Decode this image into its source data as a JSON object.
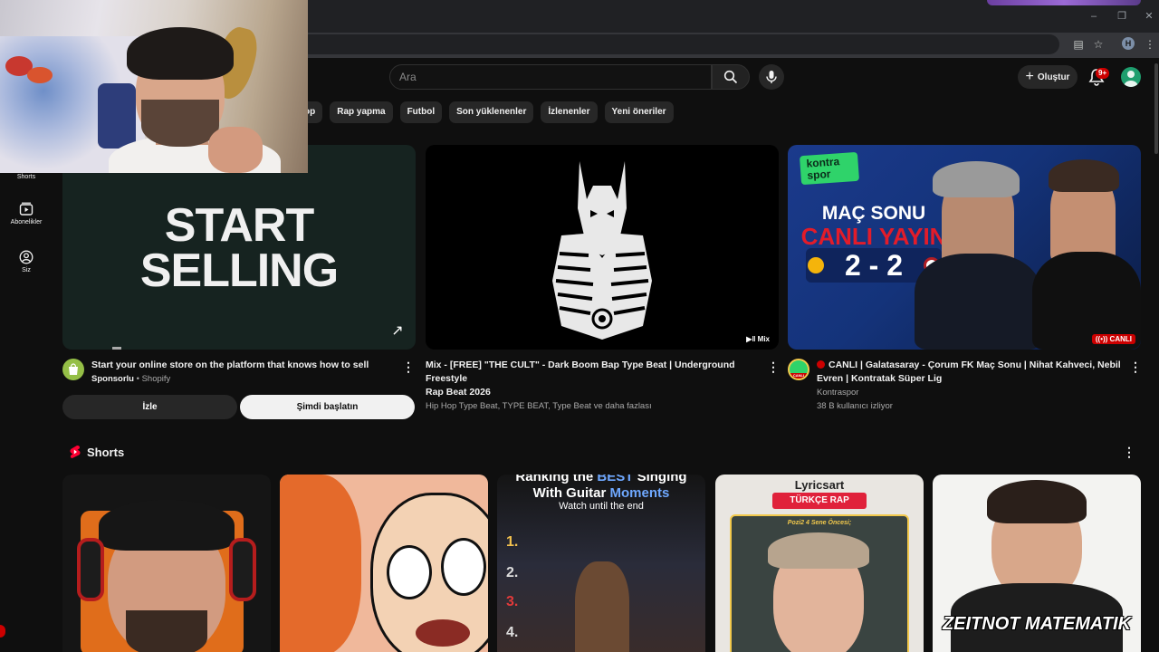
{
  "header": {
    "search_placeholder": "Ara",
    "create_label": "Oluştur",
    "notifications_badge": "9+",
    "profile_initial": "H"
  },
  "chips": [
    "op",
    "Rap yapma",
    "Futbol",
    "Son yüklenenler",
    "İzlenenler",
    "Yeni öneriler"
  ],
  "sidebar": {
    "items": [
      {
        "label": "Shorts",
        "icon": "shorts-icon"
      },
      {
        "label": "Abonelikler",
        "icon": "subscriptions-icon"
      },
      {
        "label": "Siz",
        "icon": "you-icon"
      }
    ]
  },
  "videos": [
    {
      "thumb_text_1": "START",
      "thumb_text_2": "SELLING",
      "title": "Start your online store on the platform that knows how to sell",
      "sponsored": "Sponsorlu",
      "channel": "Shopify",
      "button_watch": "İzle",
      "button_start": "Şimdi başlatın"
    },
    {
      "badge": "Mix",
      "title_line1": "Mix - [FREE] \"THE CULT\" - Dark Boom Bap Type Beat | Underground Freestyle",
      "title_line2": "Rap Beat 2026",
      "subtitle": "Hip Hop Type Beat, TYPE BEAT, Type Beat ve daha fazlası"
    },
    {
      "logo_line1": "kontra",
      "logo_line2": "spor",
      "thumb_line1": "MAÇ SONU",
      "thumb_line2": "CANLI YAYIN",
      "score": "2 - 2",
      "live_badge": "CANLI",
      "avatar_label": "CANLI",
      "title_line1": "CANLI | Galatasaray - Çorum FK Maç Sonu | Nihat Kahveci, Nebil",
      "title_line2": "Evren | Kontratak Süper Lig",
      "channel": "Kontraspor",
      "viewers": "38 B kullanıcı izliyor"
    }
  ],
  "shorts": {
    "title": "Shorts",
    "items": [
      {
        "line1_a": "Ranking the ",
        "line1_b": "BEST",
        "line1_c": " Singing",
        "line2_a": "With Guitar ",
        "line2_b": "Moments",
        "line3": "Watch until the end",
        "nums": [
          "1.",
          "2.",
          "3.",
          "4."
        ]
      },
      {
        "brand": "Lyricsart",
        "tag": "TÜRKÇE RAP",
        "caption": "Pozi2 4 Sene Öncesi;"
      },
      {
        "title": "ZEITNOT MATEMATIK"
      }
    ]
  },
  "colors": {
    "background": "#0f0f0f",
    "chip": "#272727",
    "accent_red": "#cc0000",
    "avatar_green": "#1e9e6e"
  }
}
